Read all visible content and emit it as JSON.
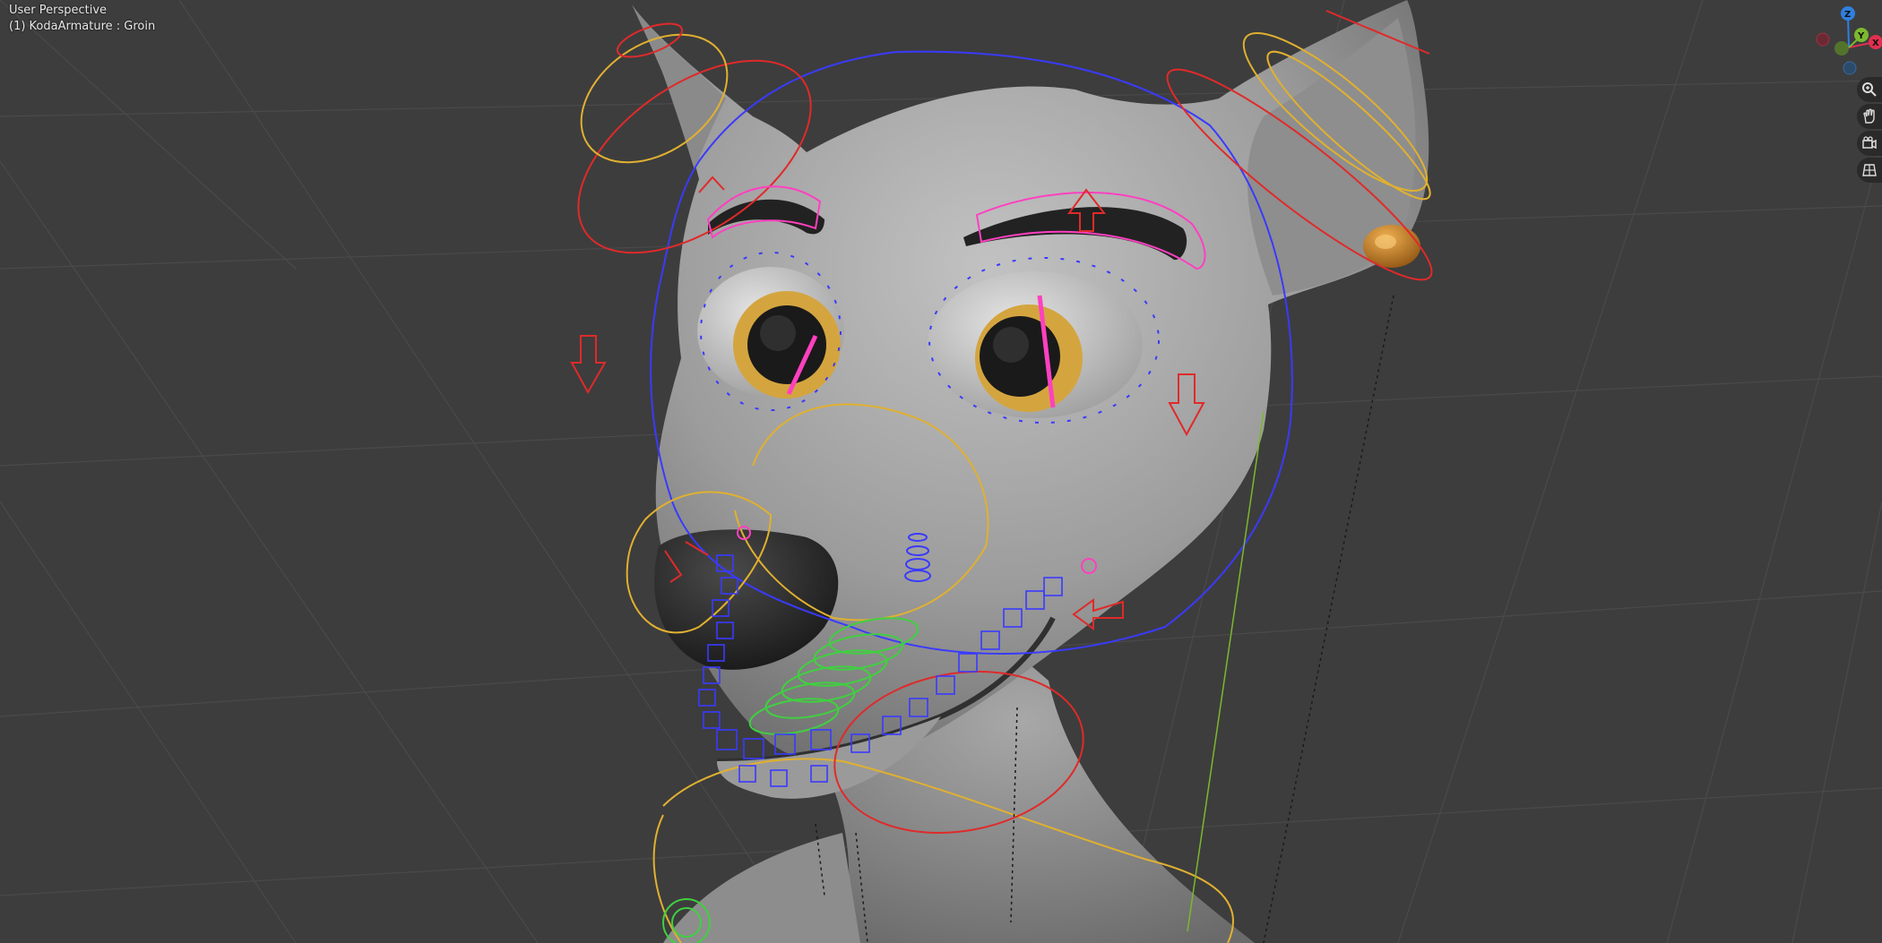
{
  "viewport": {
    "view_label": "User Perspective",
    "object_info": "(1) KodaArmature : Groin",
    "background": "#3d3d3d"
  },
  "gizmo": {
    "axes": [
      {
        "label": "Z",
        "color": "#2f7fe0"
      },
      {
        "label": "Y",
        "color": "#7cb82f"
      },
      {
        "label": "X",
        "color": "#e0304f"
      }
    ]
  },
  "nav_tools": [
    {
      "name": "zoom-icon"
    },
    {
      "name": "hand-pan-icon"
    },
    {
      "name": "camera-icon"
    },
    {
      "name": "grid-ortho-icon"
    }
  ],
  "colors": {
    "mesh": "#a6a6a6",
    "bone_red": "#e02a2a",
    "bone_yellow": "#e0b030",
    "bone_blue": "#3a3aff",
    "bone_green": "#40d040",
    "bone_pink": "#ff40c0",
    "earring": "#c88a2c",
    "iris": "#d4a53f"
  }
}
